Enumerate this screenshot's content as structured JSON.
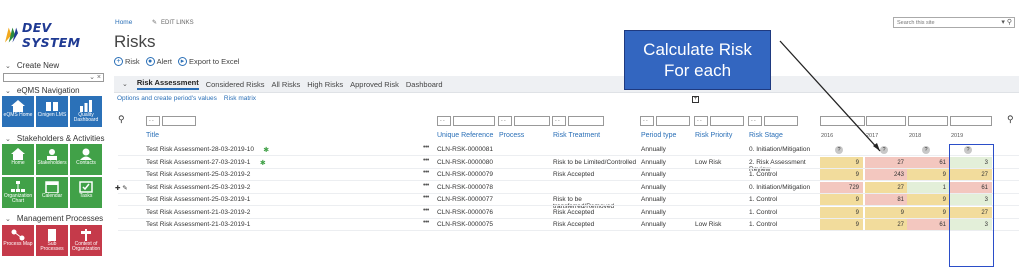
{
  "app": {
    "name": "DEV SYSTEM"
  },
  "nav": {
    "create_new": "Create New",
    "eqms_nav": "eQMS Navigation",
    "stakeholders": "Stakeholders & Activities",
    "mgmt": "Management Processes",
    "tiles_eqms": [
      "eQMS Home",
      "Cinigen LMS",
      "Quality Dashboard"
    ],
    "tiles_stake": [
      "Home",
      "Stakeholders",
      "Contacts"
    ],
    "tiles_org": [
      "Organization Chart",
      "Calendar",
      "Tasks"
    ],
    "tiles_mgmt": [
      "Process Map",
      "Sub Processes",
      "Context of Organization"
    ]
  },
  "header": {
    "breadcrumb": "Home",
    "edit_links": "EDIT LINKS",
    "title": "Risks",
    "search_placeholder": "Search this site"
  },
  "actions": [
    {
      "icon": "plus",
      "label": "Risk"
    },
    {
      "icon": "alert",
      "label": "Alert"
    },
    {
      "icon": "export",
      "label": "Export to Excel"
    }
  ],
  "callout": {
    "line1": "Calculate Risk",
    "line2": "For each"
  },
  "tabs": [
    "Risk Assessment",
    "Considered Risks",
    "All Risks",
    "High Risks",
    "Approved Risk",
    "Dashboard"
  ],
  "sublinks": [
    "Options and create period's values",
    "Risk matrix"
  ],
  "filter_select_placeholder": "- -",
  "columns": {
    "title": "Title",
    "ref": "Unique Reference",
    "process": "Process",
    "treatment": "Risk Treatment",
    "period": "Period type",
    "priority": "Risk Priority",
    "stage": "Risk Stage",
    "years": [
      "2016",
      "2017",
      "2018",
      "2019"
    ]
  },
  "rows": [
    {
      "title": "Test Risk Assessment-28-03-2019-10",
      "new": true,
      "ref": "CLN-RSK-0000081",
      "treatment": "",
      "period": "Annually",
      "priority": "",
      "stage": "0. Initiation/Mitigation",
      "badges": [
        "?",
        "?",
        "?",
        "?"
      ],
      "vals": [
        "",
        "",
        "",
        ""
      ]
    },
    {
      "title": "Test Risk Assessment-27-03-2019-1",
      "new": true,
      "ref": "CLN-RSK-0000080",
      "treatment": "Risk to be Limited/Controlled",
      "period": "Annually",
      "priority": "Low Risk",
      "stage": "2. Risk Assessment",
      "stage2": "Review",
      "vals": [
        "9",
        "27",
        "61",
        "3"
      ],
      "colors": [
        "#f2dc9c",
        "#f3c7bf",
        "#f3c7bf",
        "#e3efd9"
      ]
    },
    {
      "title": "Test Risk Assessment-25-03-2019-2",
      "ref": "CLN-RSK-0000079",
      "treatment": "Risk Accepted",
      "period": "Annually",
      "priority": "",
      "stage": "1. Control",
      "vals": [
        "9",
        "243",
        "9",
        "27"
      ],
      "colors": [
        "#f2dc9c",
        "#f3c7bf",
        "#f2dc9c",
        "#f2dc9c"
      ]
    },
    {
      "title": "Test Risk Assessment-25-03-2019-2",
      "ref": "CLN-RSK-0000078",
      "treatment": "",
      "period": "Annually",
      "priority": "",
      "stage": "0. Initiation/Mitigation",
      "vals": [
        "729",
        "27",
        "1",
        "61"
      ],
      "colors": [
        "#f3c7bf",
        "#f2dc9c",
        "#e3efd9",
        "#f3c7bf"
      ]
    },
    {
      "title": "Test Risk Assessment-25-03-2019-1",
      "ref": "CLN-RSK-0000077",
      "treatment": "Risk to be",
      "treatment2": "transferred/Removed",
      "period": "Annually",
      "priority": "",
      "stage": "1. Control",
      "vals": [
        "9",
        "81",
        "9",
        "3"
      ],
      "colors": [
        "#f2dc9c",
        "#f3c7bf",
        "#f2dc9c",
        "#e3efd9"
      ]
    },
    {
      "title": "Test Risk Assessment-21-03-2019-2",
      "ref": "CLN-RSK-0000076",
      "treatment": "Risk Accepted",
      "period": "Annually",
      "priority": "",
      "stage": "1. Control",
      "vals": [
        "9",
        "9",
        "9",
        "27"
      ],
      "colors": [
        "#f2dc9c",
        "#f2dc9c",
        "#f2dc9c",
        "#f2dc9c"
      ]
    },
    {
      "title": "Test Risk Assessment-21-03-2019-1",
      "ref": "CLN-RSK-0000075",
      "treatment": "Risk Accepted",
      "period": "Annually",
      "priority": "Low Risk",
      "stage": "1. Control",
      "vals": [
        "9",
        "27",
        "61",
        "3"
      ],
      "colors": [
        "#f2dc9c",
        "#f2dc9c",
        "#f3c7bf",
        "#e3efd9"
      ]
    }
  ]
}
